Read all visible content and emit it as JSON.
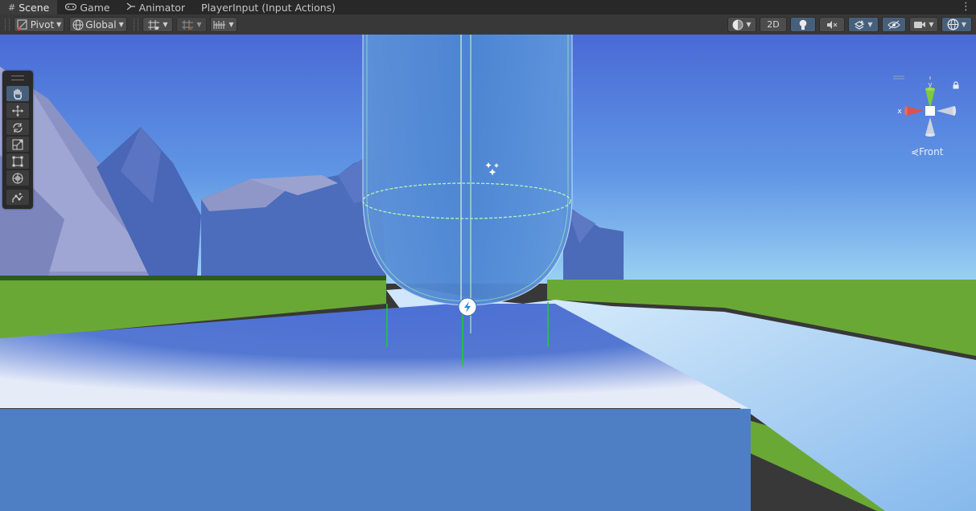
{
  "tabs": [
    {
      "label": "Scene",
      "icon": "grid-icon",
      "active": true
    },
    {
      "label": "Game",
      "icon": "gamepad-icon",
      "active": false
    },
    {
      "label": "Animator",
      "icon": "animator-icon",
      "active": false
    },
    {
      "label": "PlayerInput (Input Actions)",
      "icon": "",
      "active": false
    }
  ],
  "toolbar": {
    "pivot_label": "Pivot",
    "global_label": "Global",
    "mode_2d_label": "2D"
  },
  "scene_tools": [
    "hand-tool",
    "move-tool",
    "rotate-tool",
    "scale-tool",
    "rect-tool",
    "transform-tool",
    "custom-tool"
  ],
  "gizmo": {
    "view_label": "Front",
    "x_axis_label": "x",
    "y_axis_label": "y"
  },
  "colors": {
    "sky_top": "#4a6fd8",
    "sky_horizon": "#8cc4f0",
    "grass": "#6aa836",
    "platform": "#4e7fc4",
    "capsule": "#4f8ad8",
    "gizmo_x": "#d9534f",
    "gizmo_y": "#7fc83f",
    "toolbar_active": "#46607c"
  }
}
